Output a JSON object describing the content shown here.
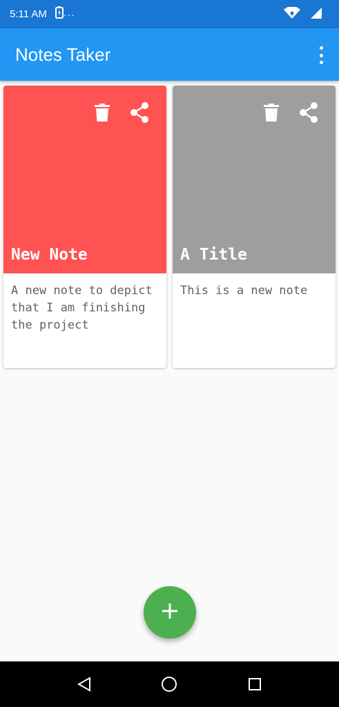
{
  "status_bar": {
    "time": "5:11 AM",
    "overflow_dots": "···"
  },
  "app_bar": {
    "title": "Notes Taker"
  },
  "notes": [
    {
      "title": "New Note",
      "body": "A new note to depict that I am finishing the project",
      "color": "#ff5252"
    },
    {
      "title": "A Title",
      "body": "This is a new note",
      "color": "#9e9e9e"
    }
  ],
  "colors": {
    "status_bar": "#1976d2",
    "app_bar": "#2196f3",
    "fab": "#4caf50"
  },
  "icons": {
    "delete": "delete-icon",
    "share": "share-icon",
    "add": "add-icon",
    "overflow": "more-vert-icon"
  }
}
